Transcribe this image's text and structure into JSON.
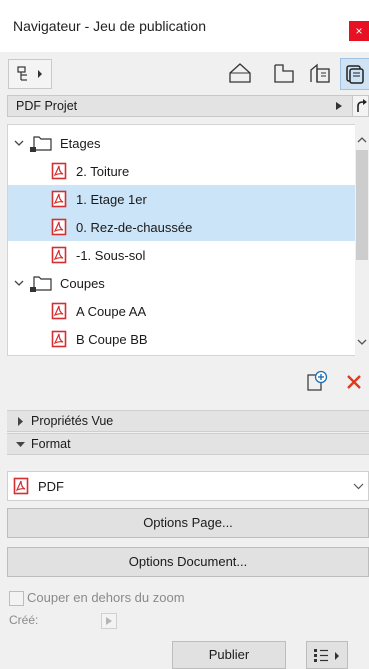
{
  "window": {
    "title": "Navigateur - Jeu de publication",
    "close_glyph": "×"
  },
  "header_row": {
    "label": "PDF Projet"
  },
  "tree": [
    {
      "label": "Etages",
      "kind": "folder"
    },
    {
      "label": "2. Toiture",
      "kind": "pdf",
      "selected": false
    },
    {
      "label": "1. Etage 1er",
      "kind": "pdf",
      "selected": true
    },
    {
      "label": "0. Rez-de-chaussée",
      "kind": "pdf",
      "selected": true
    },
    {
      "label": "-1. Sous-sol",
      "kind": "pdf",
      "selected": false
    },
    {
      "label": "Coupes",
      "kind": "folder"
    },
    {
      "label": "A Coupe AA",
      "kind": "pdf",
      "selected": false
    },
    {
      "label": "B Coupe BB",
      "kind": "pdf",
      "selected": false
    }
  ],
  "sections": {
    "proprietes": "Propriétés Vue",
    "format": "Format"
  },
  "format": {
    "selected": "PDF"
  },
  "buttons": {
    "options_page": "Options Page...",
    "options_document": "Options Document...",
    "publier": "Publier"
  },
  "checkbox": {
    "label": "Couper en dehors  du zoom",
    "checked": false
  },
  "cree": {
    "label": "Créé:"
  },
  "colors": {
    "selection": "#cce4f7",
    "pdf_red": "#d32f2f",
    "delete_red": "#e03a1e",
    "close_red": "#e81123"
  },
  "icons": [
    "navigator-map-icon",
    "house-outline-icon",
    "floorplan-icon",
    "section-icon",
    "layout-book-icon",
    "add-item-icon",
    "delete-x-icon",
    "pdf-file-icon",
    "folder-icon",
    "chevron-icon",
    "list-options-icon"
  ]
}
